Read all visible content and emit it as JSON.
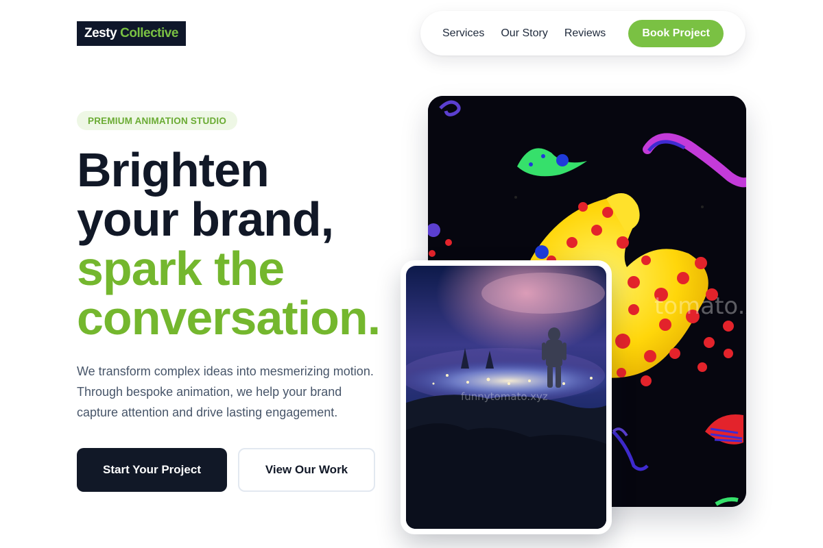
{
  "brand": {
    "name_part1": "Zesty",
    "name_part2": "Collective"
  },
  "nav": {
    "items": [
      {
        "label": "Services"
      },
      {
        "label": "Our Story"
      },
      {
        "label": "Reviews"
      }
    ],
    "cta_label": "Book Project"
  },
  "hero": {
    "badge": "PREMIUM ANIMATION STUDIO",
    "headline_line1": "Brighten",
    "headline_line2": "your brand,",
    "headline_line3": "spark the",
    "headline_line4": "conversation.",
    "description_lines": [
      "We transform complex ideas into mesmerizing motion.",
      "Through bespoke animation, we help your brand",
      "capture attention and drive lasting engagement."
    ],
    "primary_button": "Start Your Project",
    "secondary_button": "View Our Work"
  },
  "images": {
    "large_watermark": "tomato.xyz",
    "small_watermark": "funnytomato.xyz"
  },
  "colors": {
    "accent": "#7ac143",
    "dark": "#0f172a"
  }
}
